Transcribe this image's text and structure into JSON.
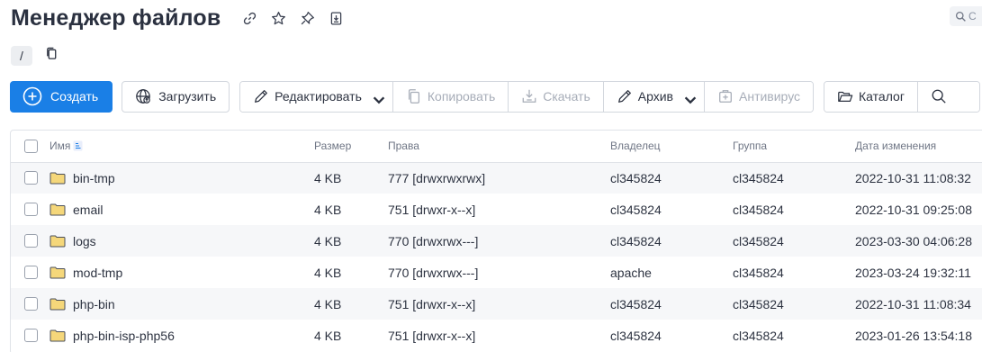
{
  "header": {
    "title": "Менеджер файлов",
    "icons": [
      "link-icon",
      "star-icon",
      "pin-icon",
      "download-doc-icon"
    ],
    "search_placeholder": "С"
  },
  "breadcrumb": {
    "root": "/"
  },
  "toolbar": {
    "create": "Создать",
    "upload": "Загрузить",
    "edit": "Редактировать",
    "copy": "Копировать",
    "download": "Скачать",
    "archive": "Архив",
    "antivirus": "Антивирус",
    "catalog": "Каталог"
  },
  "table": {
    "columns": {
      "name": "Имя",
      "size": "Размер",
      "rights": "Права",
      "owner": "Владелец",
      "group": "Группа",
      "modified": "Дата изменения"
    },
    "rows": [
      {
        "name": "bin-tmp",
        "size": "4 KB",
        "rights": "777 [drwxrwxrwx]",
        "owner": "cl345824",
        "group": "cl345824",
        "modified": "2022-10-31 11:08:32"
      },
      {
        "name": "email",
        "size": "4 KB",
        "rights": "751 [drwxr-x--x]",
        "owner": "cl345824",
        "group": "cl345824",
        "modified": "2022-10-31 09:25:08"
      },
      {
        "name": "logs",
        "size": "4 KB",
        "rights": "770 [drwxrwx---]",
        "owner": "cl345824",
        "group": "cl345824",
        "modified": "2023-03-30 04:06:28"
      },
      {
        "name": "mod-tmp",
        "size": "4 KB",
        "rights": "770 [drwxrwx---]",
        "owner": "apache",
        "group": "cl345824",
        "modified": "2023-03-24 19:32:11"
      },
      {
        "name": "php-bin",
        "size": "4 KB",
        "rights": "751 [drwxr-x--x]",
        "owner": "cl345824",
        "group": "cl345824",
        "modified": "2022-10-31 11:08:34"
      },
      {
        "name": "php-bin-isp-php56",
        "size": "4 KB",
        "rights": "751 [drwxr-x--x]",
        "owner": "cl345824",
        "group": "cl345824",
        "modified": "2023-01-26 13:54:18"
      }
    ]
  },
  "colors": {
    "primary": "#1a7fe6",
    "folder": "#f5d77a",
    "folder_stroke": "#4a4f5a",
    "row_alt": "#f6f7f9"
  }
}
